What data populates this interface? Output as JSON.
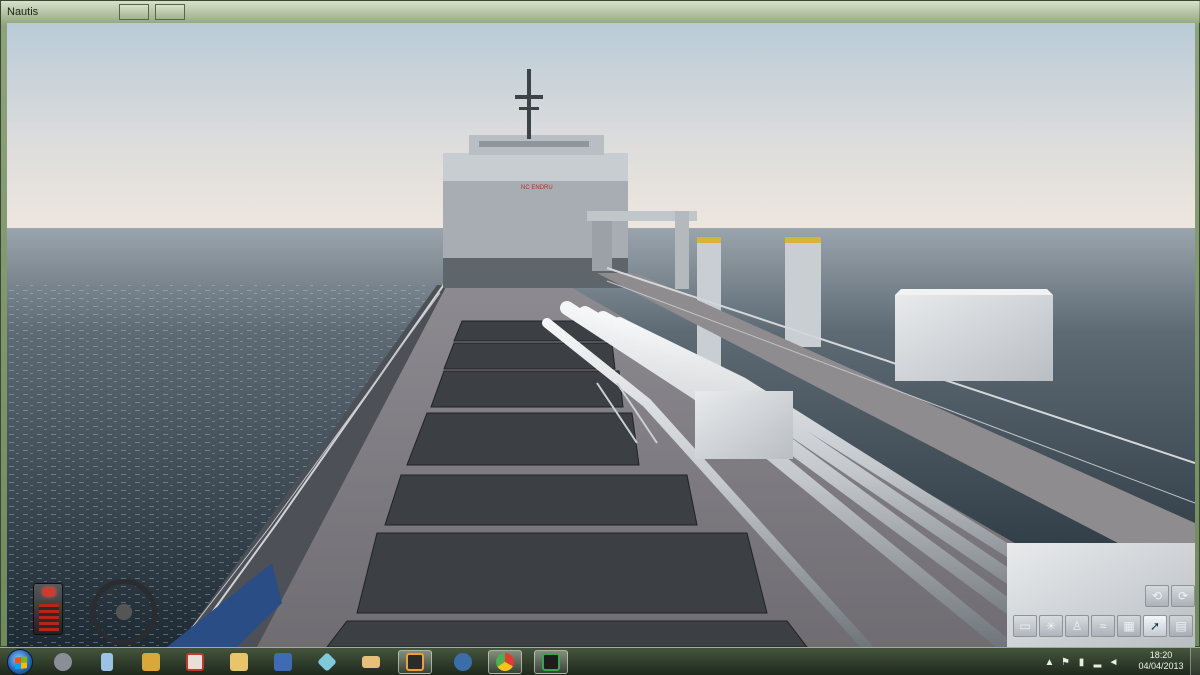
{
  "window": {
    "title": "Nautis"
  },
  "scene": {
    "description_icons": [
      "tanker-deck-view"
    ],
    "sky_colors": [
      "#e9e6e2",
      "#c9d3dc",
      "#aec4d4"
    ],
    "sea_color": "#3b4a58",
    "deck_color": "#7c7b80",
    "superstructure_text": "NC ENDRU"
  },
  "hud": {
    "left": {
      "light_icon": "signal-light-icon",
      "wheel_icon": "steering-wheel-icon"
    },
    "tools_row1": [
      "rewind-icon",
      "forward-icon"
    ],
    "tools_row2": [
      "minimize-icon",
      "snowflake-icon",
      "person-icon",
      "wave-icon",
      "grid-icon",
      "pointer-icon",
      "dashboard-icon"
    ]
  },
  "taskbar": {
    "start_icon": "windows-start-icon",
    "pinned": [
      {
        "name": "settings-icon",
        "color": "#8a8f96"
      },
      {
        "name": "calculator-icon",
        "color": "#9cc3e6"
      },
      {
        "name": "app-crown-icon",
        "color": "#d9a838"
      },
      {
        "name": "zoom-icon",
        "color": "#e8e0d6"
      },
      {
        "name": "explorer-icon",
        "color": "#e8c46a"
      },
      {
        "name": "word-icon",
        "color": "#3f6bb5"
      },
      {
        "name": "crystal-icon",
        "color": "#7fc9d8"
      },
      {
        "name": "folder-app-icon",
        "color": "#e6c07a"
      },
      {
        "name": "xmind-icon",
        "color": "#2b2b2b"
      },
      {
        "name": "thunderbird-icon",
        "color": "#3b6ea8"
      },
      {
        "name": "chrome-icon",
        "color": "#4caf50"
      },
      {
        "name": "media-player-icon",
        "color": "#2fa84f"
      }
    ],
    "tray_icons": [
      "up-arrow-icon",
      "flag-icon",
      "battery-icon",
      "signal-icon",
      "volume-icon"
    ],
    "clock_time": "18:20",
    "clock_date": "04/04/2013"
  }
}
